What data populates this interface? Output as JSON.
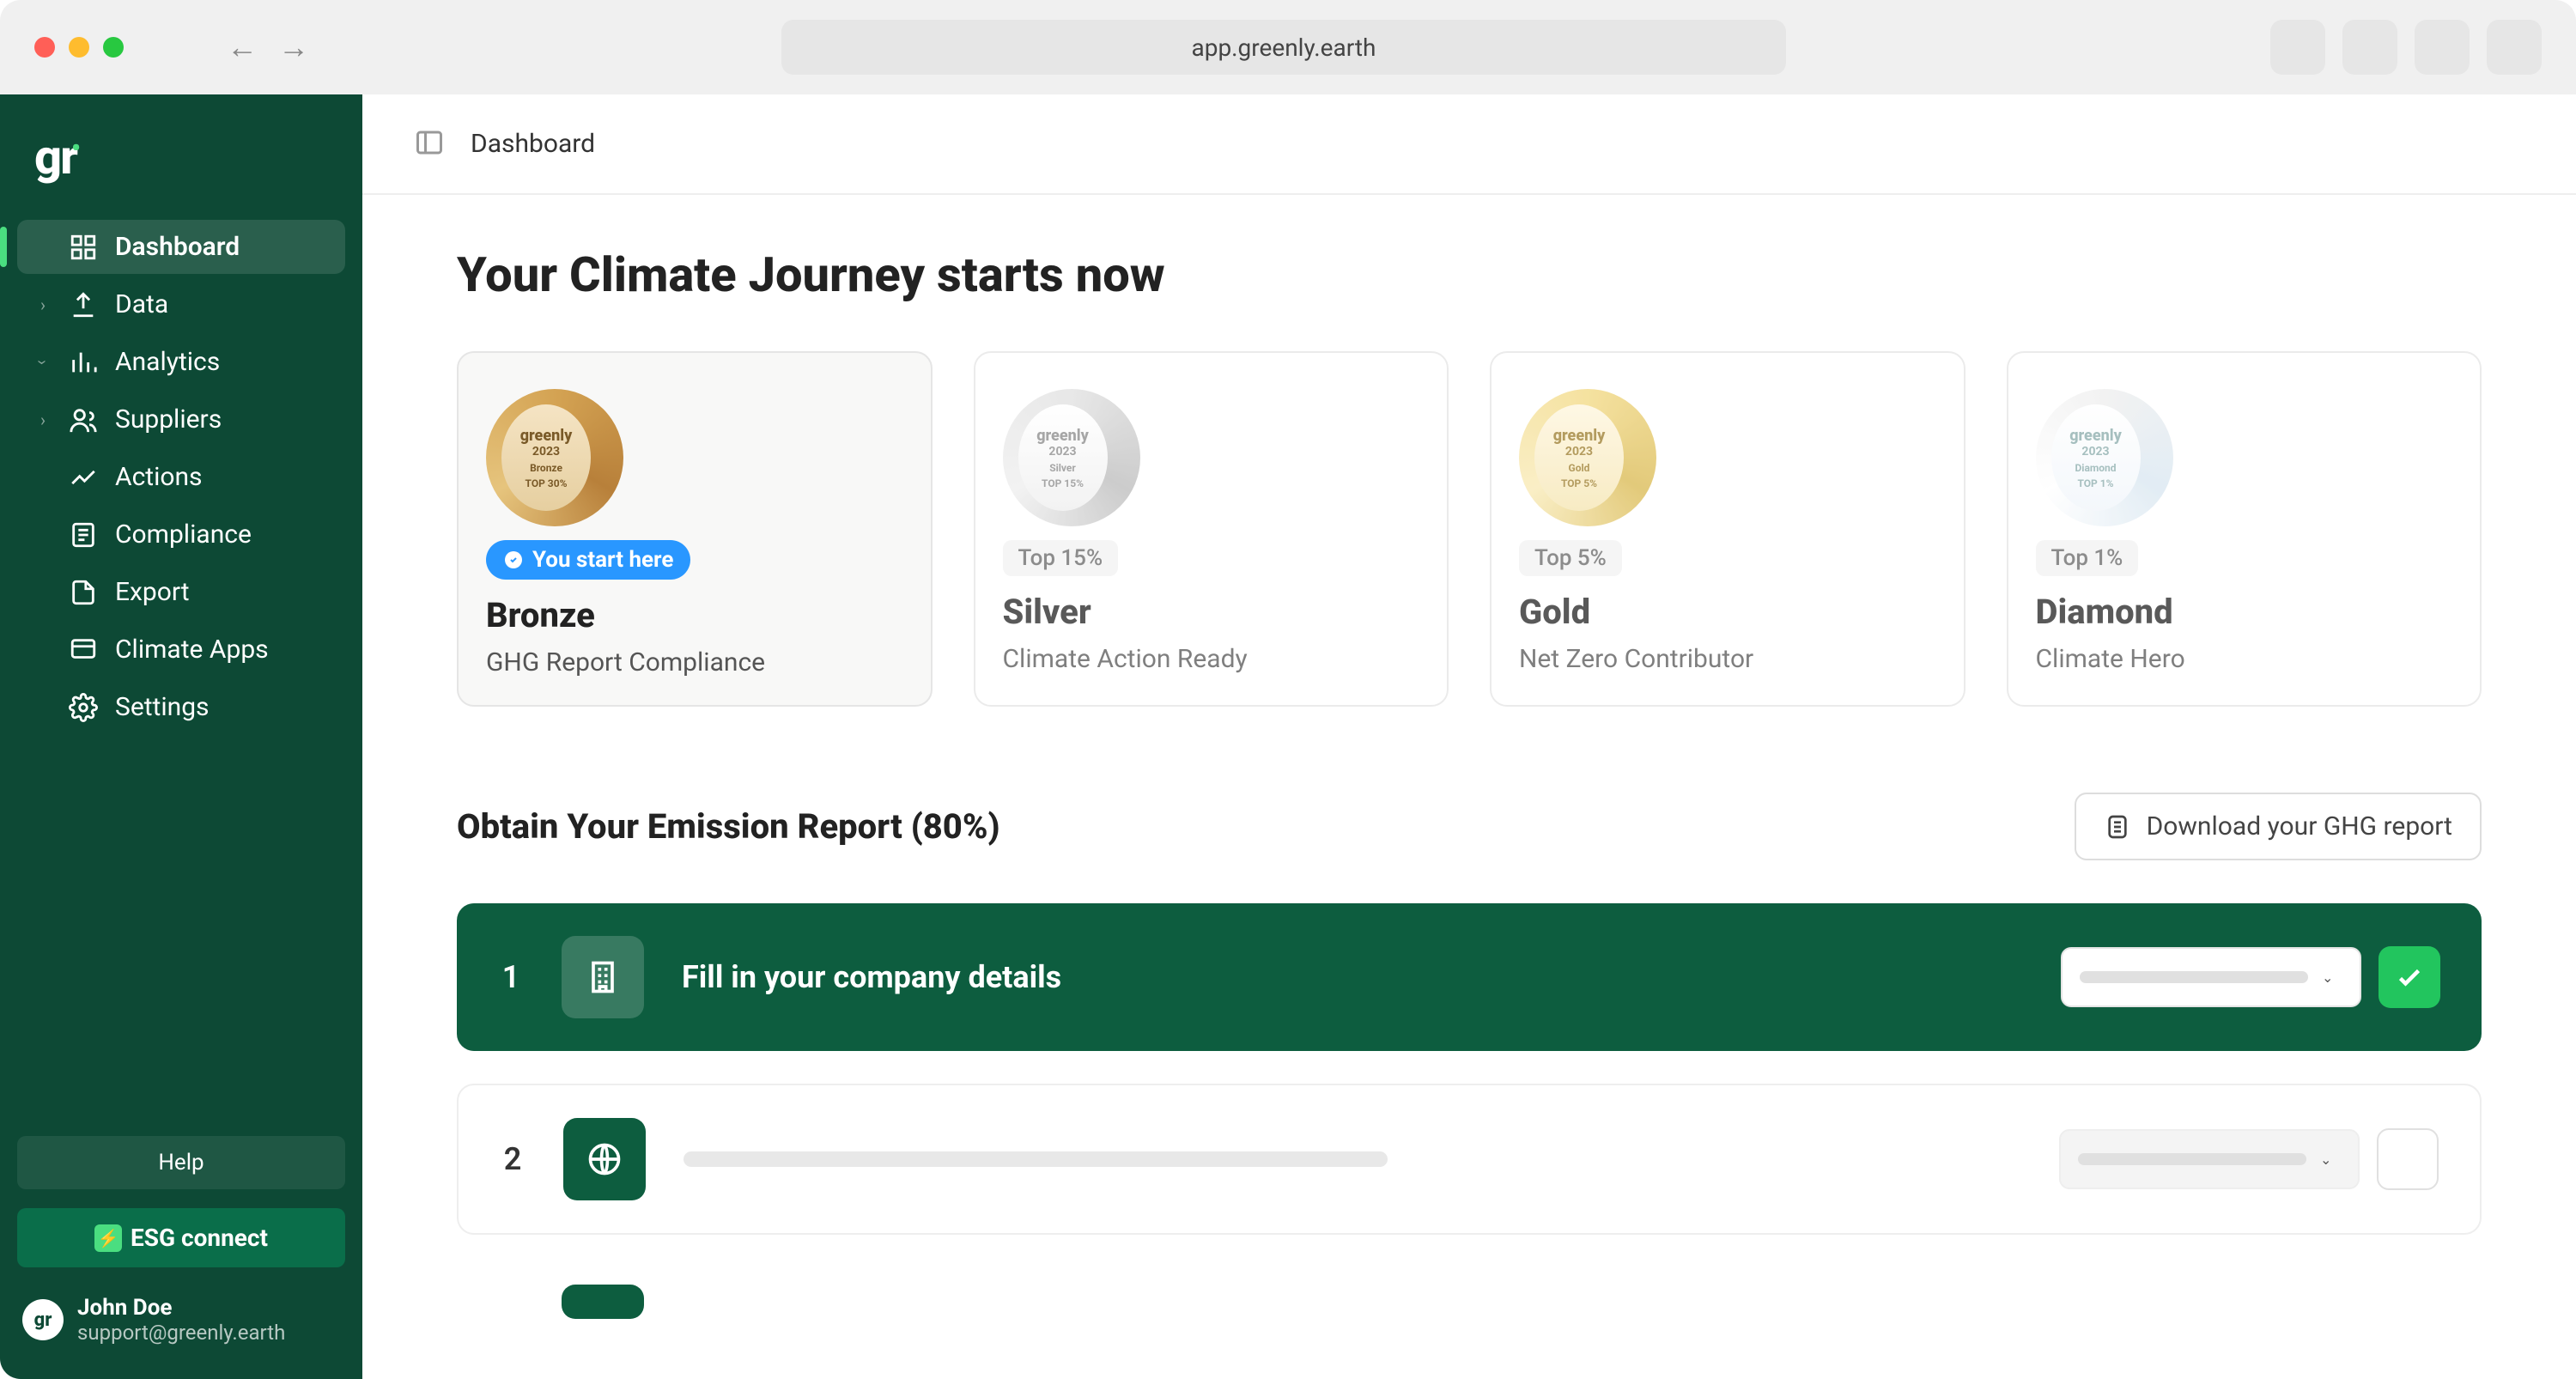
{
  "browser": {
    "url": "app.greenly.earth"
  },
  "sidebar": {
    "logo": "gr",
    "items": [
      {
        "label": "Dashboard",
        "active": true
      },
      {
        "label": "Data"
      },
      {
        "label": "Analytics"
      },
      {
        "label": "Suppliers"
      },
      {
        "label": "Actions"
      },
      {
        "label": "Compliance"
      },
      {
        "label": "Export"
      },
      {
        "label": "Climate Apps"
      },
      {
        "label": "Settings"
      }
    ],
    "help": "Help",
    "esg": "ESG connect",
    "user": {
      "name": "John Doe",
      "email": "support@greenly.earth",
      "initials": "gr"
    }
  },
  "topbar": {
    "breadcrumb": "Dashboard"
  },
  "page": {
    "title": "Your Climate Journey starts now",
    "tiers": [
      {
        "name": "Bronze",
        "desc": "GHG Report Compliance",
        "pill_type": "start",
        "pill": "You start here",
        "year": "2023",
        "brand": "greenly",
        "level": "Bronze",
        "top": "TOP 30%"
      },
      {
        "name": "Silver",
        "desc": "Climate Action Ready",
        "pill_type": "top",
        "pill": "Top 15%",
        "year": "2023",
        "brand": "greenly",
        "level": "Silver",
        "top": "TOP 15%"
      },
      {
        "name": "Gold",
        "desc": "Net Zero Contributor",
        "pill_type": "top",
        "pill": "Top 5%",
        "year": "2023",
        "brand": "greenly",
        "level": "Gold",
        "top": "TOP 5%"
      },
      {
        "name": "Diamond",
        "desc": "Climate Hero",
        "pill_type": "top",
        "pill": "Top 1%",
        "year": "2023",
        "brand": "greenly",
        "level": "Diamond",
        "top": "TOP 1%"
      }
    ],
    "section_title": "Obtain Your Emission Report (80%)",
    "download_label": "Download your GHG report",
    "steps": [
      {
        "num": "1",
        "title": "Fill in your company details",
        "state": "done"
      },
      {
        "num": "2",
        "title": "",
        "state": "pending"
      }
    ]
  }
}
